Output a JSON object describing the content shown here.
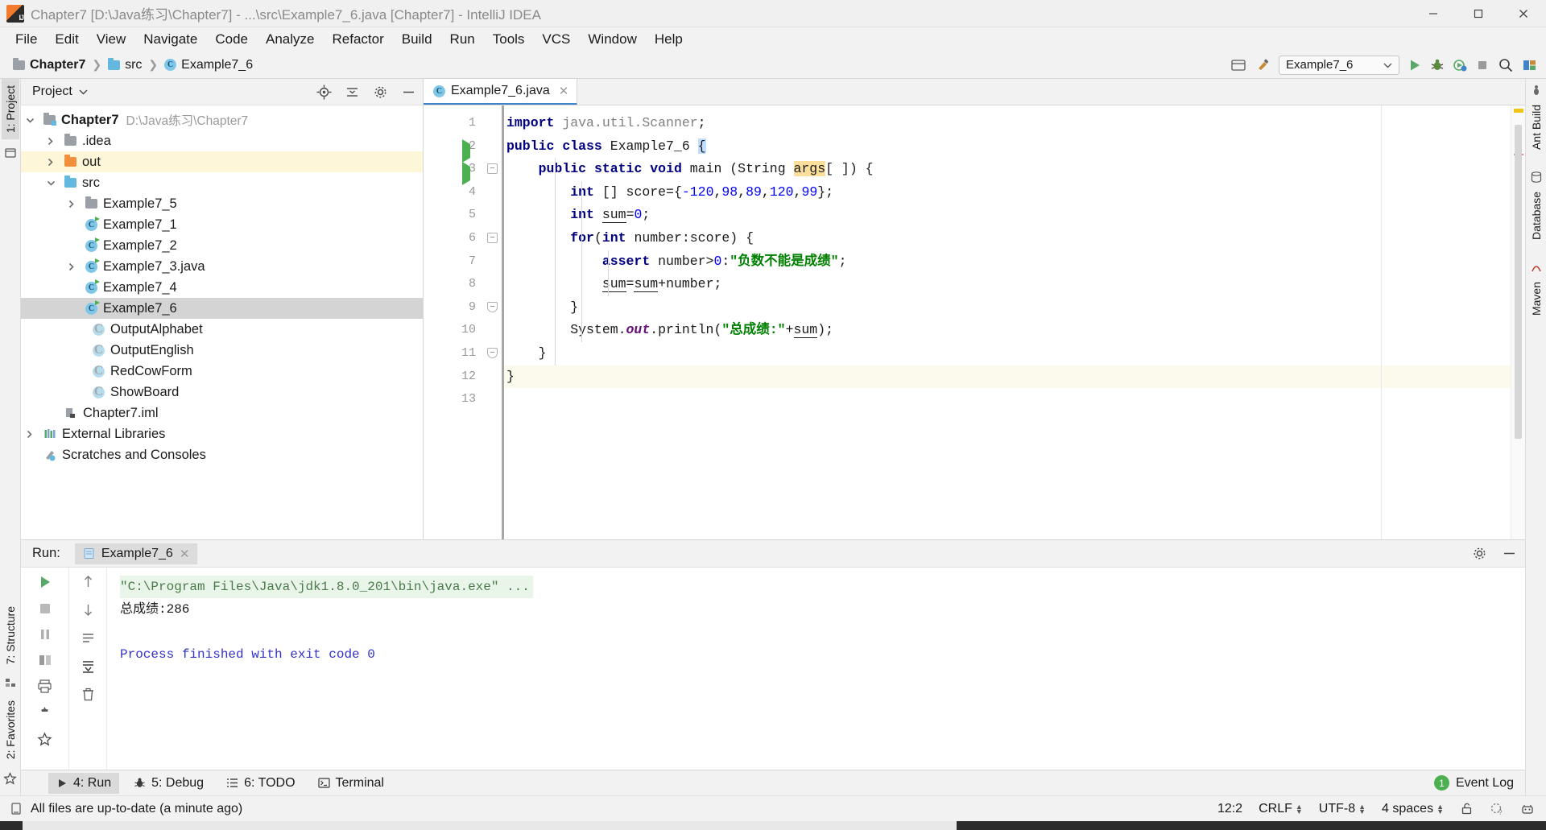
{
  "window": {
    "title": "Chapter7 [D:\\Java练习\\Chapter7] - ...\\src\\Example7_6.java [Chapter7] - IntelliJ IDEA",
    "minimize_label": "—",
    "maximize_label": "❐",
    "close_label": "✕"
  },
  "menubar": {
    "items": [
      {
        "label": "File"
      },
      {
        "label": "Edit"
      },
      {
        "label": "View"
      },
      {
        "label": "Navigate"
      },
      {
        "label": "Code"
      },
      {
        "label": "Analyze"
      },
      {
        "label": "Refactor"
      },
      {
        "label": "Build"
      },
      {
        "label": "Run"
      },
      {
        "label": "Tools"
      },
      {
        "label": "VCS"
      },
      {
        "label": "Window"
      },
      {
        "label": "Help"
      }
    ]
  },
  "navbar": {
    "breadcrumbs": [
      {
        "label": "Chapter7",
        "icon": "folder-module-icon"
      },
      {
        "label": "src",
        "icon": "folder-source-icon"
      },
      {
        "label": "Example7_6",
        "icon": "java-class-icon"
      }
    ],
    "run_config": "Example7_6",
    "buttons": {
      "run": "run-icon",
      "debug": "debug-icon",
      "run_coverage": "run-with-coverage-icon",
      "stop": "stop-icon",
      "search": "search-icon",
      "layout": "layout-icon",
      "make_project": "make-project-icon",
      "select_target": "select-in-icon"
    }
  },
  "left_strip": {
    "tabs": [
      {
        "label": "1: Project",
        "selected": true
      },
      {
        "label": "7: Structure",
        "selected": false
      },
      {
        "label": "2: Favorites",
        "selected": false
      }
    ]
  },
  "right_strip": {
    "tabs": [
      {
        "label": "Ant Build"
      },
      {
        "label": "Database"
      },
      {
        "label": "Maven"
      }
    ]
  },
  "project_pane": {
    "title": "Project",
    "dropdown_icon": "chevron-down-icon",
    "tools": [
      "locate-icon",
      "collapse-all-icon",
      "settings-gear-icon",
      "hide-icon"
    ],
    "tree": [
      {
        "depth": 0,
        "arrow": "expanded",
        "icon": "folder-module-icon",
        "label": "Chapter7",
        "bold": true,
        "suffix": "D:\\Java练习\\Chapter7",
        "state": "normal"
      },
      {
        "depth": 1,
        "arrow": "collapsed",
        "icon": "folder-gray-icon",
        "label": ".idea",
        "bold": false,
        "suffix": "",
        "state": "normal"
      },
      {
        "depth": 1,
        "arrow": "collapsed",
        "icon": "folder-orange-icon",
        "label": "out",
        "bold": false,
        "suffix": "",
        "state": "highlight"
      },
      {
        "depth": 1,
        "arrow": "expanded",
        "icon": "folder-blue-icon",
        "label": "src",
        "bold": false,
        "suffix": "",
        "state": "normal"
      },
      {
        "depth": 2,
        "arrow": "collapsed",
        "icon": "folder-gray-icon",
        "label": "Example7_5",
        "bold": false,
        "suffix": "",
        "state": "normal"
      },
      {
        "depth": 2,
        "arrow": "none",
        "icon": "java-class-run-icon",
        "label": "Example7_1",
        "bold": false,
        "suffix": "",
        "state": "normal"
      },
      {
        "depth": 2,
        "arrow": "none",
        "icon": "java-class-run-icon",
        "label": "Example7_2",
        "bold": false,
        "suffix": "",
        "state": "normal"
      },
      {
        "depth": 2,
        "arrow": "collapsed",
        "icon": "java-class-run-icon",
        "label": "Example7_3.java",
        "bold": false,
        "suffix": "",
        "state": "normal"
      },
      {
        "depth": 2,
        "arrow": "none",
        "icon": "java-class-run-icon",
        "label": "Example7_4",
        "bold": false,
        "suffix": "",
        "state": "normal"
      },
      {
        "depth": 2,
        "arrow": "none",
        "icon": "java-class-run-icon",
        "label": "Example7_6",
        "bold": false,
        "suffix": "",
        "state": "selected"
      },
      {
        "depth": 2,
        "arrow": "none",
        "icon": "java-class-icon",
        "label": "OutputAlphabet",
        "bold": false,
        "suffix": "",
        "state": "normal"
      },
      {
        "depth": 2,
        "arrow": "none",
        "icon": "java-class-icon",
        "label": "OutputEnglish",
        "bold": false,
        "suffix": "",
        "state": "normal"
      },
      {
        "depth": 2,
        "arrow": "none",
        "icon": "java-class-icon",
        "label": "RedCowForm",
        "bold": false,
        "suffix": "",
        "state": "normal"
      },
      {
        "depth": 2,
        "arrow": "none",
        "icon": "java-class-icon",
        "label": "ShowBoard",
        "bold": false,
        "suffix": "",
        "state": "normal"
      },
      {
        "depth": 1,
        "arrow": "none",
        "icon": "iml-file-icon",
        "label": "Chapter7.iml",
        "bold": false,
        "suffix": "",
        "state": "normal"
      },
      {
        "depth": 0,
        "arrow": "collapsed",
        "icon": "external-libraries-icon",
        "label": "External Libraries",
        "bold": false,
        "suffix": "",
        "state": "normal"
      },
      {
        "depth": 0,
        "arrow": "none",
        "icon": "scratches-icon",
        "label": "Scratches and Consoles",
        "bold": false,
        "suffix": "",
        "state": "normal"
      }
    ]
  },
  "editor": {
    "tab": {
      "label": "Example7_6.java",
      "icon": "java-class-icon",
      "close": "✕"
    },
    "lines": [
      {
        "n": 1,
        "fold": "",
        "gutter_run": false
      },
      {
        "n": 2,
        "fold": "",
        "gutter_run": true
      },
      {
        "n": 3,
        "fold": "minus",
        "gutter_run": true
      },
      {
        "n": 4,
        "fold": "",
        "gutter_run": false
      },
      {
        "n": 5,
        "fold": "",
        "gutter_run": false
      },
      {
        "n": 6,
        "fold": "minus",
        "gutter_run": false
      },
      {
        "n": 7,
        "fold": "",
        "gutter_run": false
      },
      {
        "n": 8,
        "fold": "",
        "gutter_run": false
      },
      {
        "n": 9,
        "fold": "end",
        "gutter_run": false
      },
      {
        "n": 10,
        "fold": "",
        "gutter_run": false
      },
      {
        "n": 11,
        "fold": "end",
        "gutter_run": false
      },
      {
        "n": 12,
        "fold": "",
        "gutter_run": false
      },
      {
        "n": 13,
        "fold": "",
        "gutter_run": false
      }
    ],
    "code": [
      "import java.util.Scanner;",
      "public class Example7_6 {",
      "    public static void main (String args[ ]) {",
      "        int [] score={-120,98,89,120,99};",
      "        int sum=0;",
      "        for(int number:score) {",
      "            assert number>0:\"负数不能是成绩\";",
      "            sum=sum+number;",
      "        }",
      "        System.out.println(\"总成绩:\"+sum);",
      "    }",
      "}",
      ""
    ],
    "caret_line": 12
  },
  "run_panel": {
    "label": "Run:",
    "tab": {
      "label": "Example7_6",
      "icon": "run-config-icon",
      "close": "✕"
    },
    "toolbar_left": [
      "rerun-icon",
      "stop-icon",
      "pause-icon",
      "layout-icon",
      "print-icon",
      "pin-icon",
      "star-icon"
    ],
    "toolbar_right": [
      "up-icon",
      "down-icon",
      "soft-wrap-icon",
      "scroll-to-end-icon",
      "trash-icon"
    ],
    "header_right": [
      "settings-gear-icon",
      "hide-icon"
    ],
    "console": [
      {
        "text": "\"C:\\Program Files\\Java\\jdk1.8.0_201\\bin\\java.exe\" ...",
        "type": "command"
      },
      {
        "text": "总成绩:286",
        "type": "output"
      },
      {
        "text": "",
        "type": "blank"
      },
      {
        "text": "Process finished with exit code 0",
        "type": "finished"
      }
    ]
  },
  "bottom_strip": {
    "tabs": [
      {
        "label": "4: Run",
        "icon": "run-icon",
        "selected": true
      },
      {
        "label": "5: Debug",
        "icon": "debug-icon",
        "selected": false
      },
      {
        "label": "6: TODO",
        "icon": "todo-icon",
        "selected": false
      },
      {
        "label": "Terminal",
        "icon": "terminal-icon",
        "selected": false
      }
    ],
    "event_log": {
      "label": "Event Log",
      "badge": "1"
    }
  },
  "statusbar": {
    "message": "All files are up-to-date (a minute ago)",
    "caret_position": "12:2",
    "line_separator": "CRLF",
    "encoding": "UTF-8",
    "indent": "4 spaces",
    "icons": [
      "lock-icon",
      "inspection-icon",
      "ide-settings-icon"
    ]
  },
  "colors": {
    "accent_blue": "#4083c9",
    "keyword": "#000080",
    "string": "#008000",
    "number": "#0000ff",
    "field": "#660e7a",
    "comment": "#808080",
    "selection": "#d4d4d4",
    "highlight_row": "#fdf6d8"
  }
}
